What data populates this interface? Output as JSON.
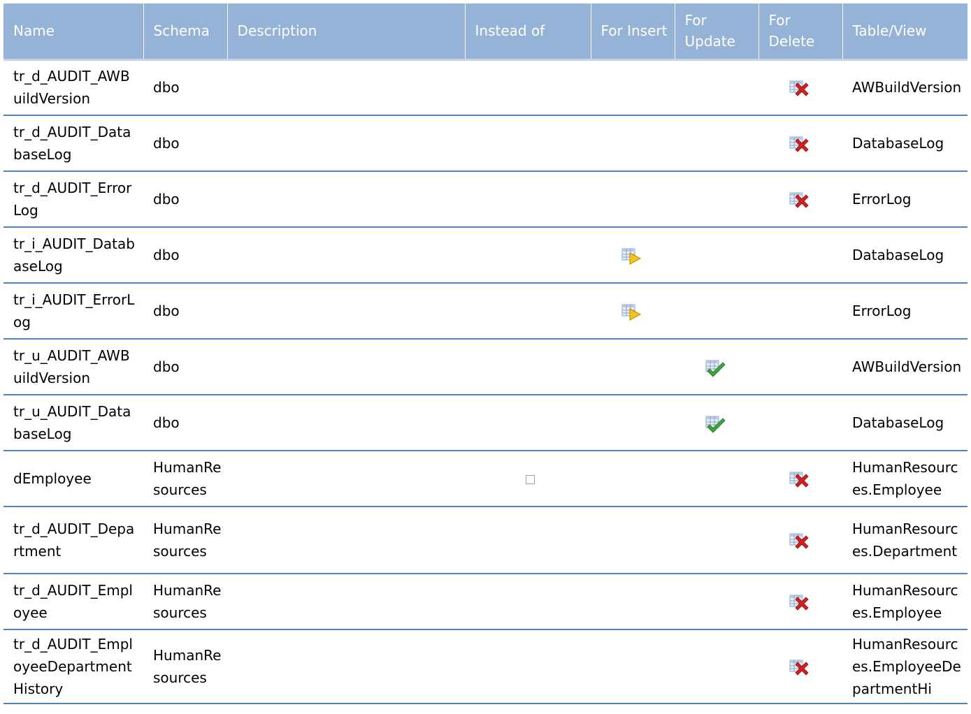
{
  "columns": [
    "Name",
    "Schema",
    "Description",
    "Instead of",
    "For Insert",
    "For Update",
    "For Delete",
    "Table/View"
  ],
  "colors": {
    "header_bg": "#95b3d7",
    "header_text": "#ffffff",
    "row_border": "#4f81bd"
  },
  "icons": {
    "delete": "table-delete-icon",
    "insert": "table-insert-icon",
    "update": "table-update-icon",
    "checkbox": "checkbox-icon"
  },
  "rows": [
    {
      "name": "tr_d_AUDIT_AWBuildVersion",
      "schema": "dbo",
      "description": "",
      "instead_of": false,
      "insert": false,
      "update": false,
      "delete": true,
      "table": "AWBuildVersion"
    },
    {
      "name": "tr_d_AUDIT_DatabaseLog",
      "schema": "dbo",
      "description": "",
      "instead_of": false,
      "insert": false,
      "update": false,
      "delete": true,
      "table": "DatabaseLog"
    },
    {
      "name": "tr_d_AUDIT_ErrorLog",
      "schema": "dbo",
      "description": "",
      "instead_of": false,
      "insert": false,
      "update": false,
      "delete": true,
      "table": "ErrorLog"
    },
    {
      "name": "tr_i_AUDIT_DatabaseLog",
      "schema": "dbo",
      "description": "",
      "instead_of": false,
      "insert": true,
      "update": false,
      "delete": false,
      "table": "DatabaseLog"
    },
    {
      "name": "tr_i_AUDIT_ErrorLog",
      "schema": "dbo",
      "description": "",
      "instead_of": false,
      "insert": true,
      "update": false,
      "delete": false,
      "table": "ErrorLog"
    },
    {
      "name": "tr_u_AUDIT_AWBuildVersion",
      "schema": "dbo",
      "description": "",
      "instead_of": false,
      "insert": false,
      "update": true,
      "delete": false,
      "table": "AWBuildVersion"
    },
    {
      "name": "tr_u_AUDIT_DatabaseLog",
      "schema": "dbo",
      "description": "",
      "instead_of": false,
      "insert": false,
      "update": true,
      "delete": false,
      "table": "DatabaseLog"
    },
    {
      "name": "dEmployee",
      "schema": "HumanResources",
      "description": "",
      "instead_of": true,
      "insert": false,
      "update": false,
      "delete": true,
      "table": "HumanResources.Employee"
    },
    {
      "name": "tr_d_AUDIT_Department",
      "schema": "HumanResources",
      "description": "",
      "instead_of": false,
      "insert": false,
      "update": false,
      "delete": true,
      "table": "HumanResources.Department"
    },
    {
      "name": "tr_d_AUDIT_Employee",
      "schema": "HumanResources",
      "description": "",
      "instead_of": false,
      "insert": false,
      "update": false,
      "delete": true,
      "table": "HumanResources.Employee"
    },
    {
      "name": "tr_d_AUDIT_EmployeeDepartmentHistory",
      "schema": "HumanResources",
      "description": "",
      "instead_of": false,
      "insert": false,
      "update": false,
      "delete": true,
      "table": "HumanResources.EmployeeDepartmentHi"
    }
  ]
}
